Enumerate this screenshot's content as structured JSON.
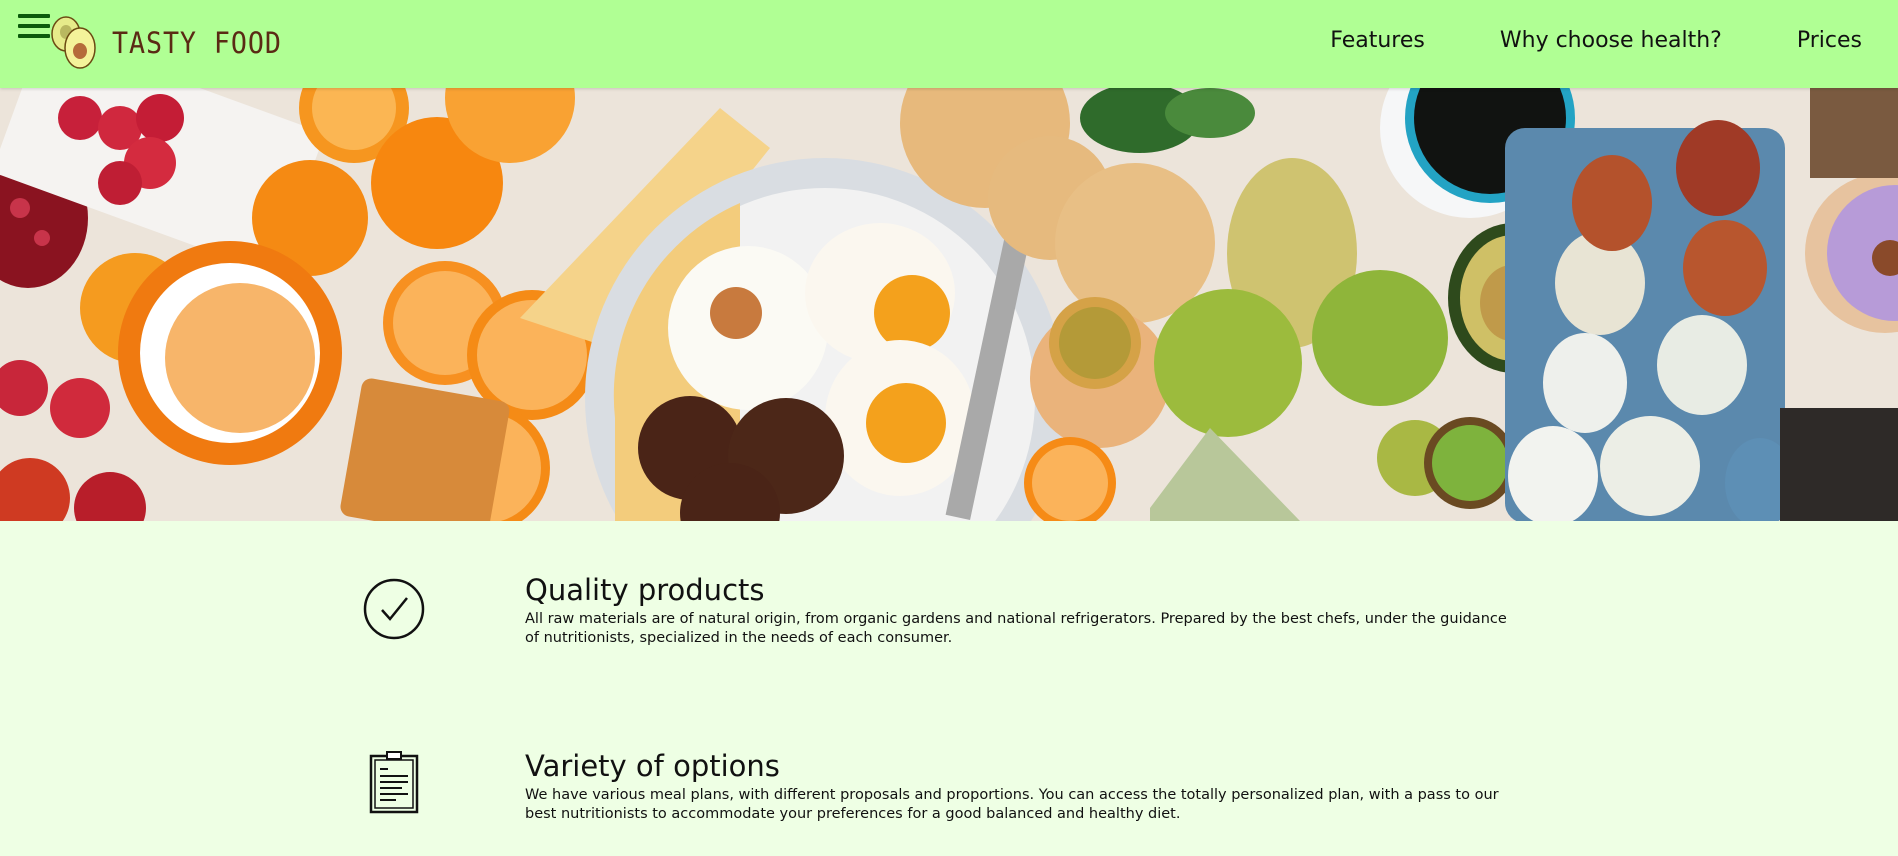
{
  "header": {
    "brand": "TASTY FOOD",
    "menu_icon": "hamburger-menu-icon",
    "logo_icon": "avocado-logo-icon",
    "nav": [
      {
        "label": "Features"
      },
      {
        "label": "Why choose health?"
      },
      {
        "label": "Prices"
      }
    ],
    "colors": {
      "background": "#b0ff94",
      "brand_text": "#5a2a14",
      "menu_icon": "#0b5a0b"
    }
  },
  "hero": {
    "image": "breakfast-foods-flatlay"
  },
  "features": [
    {
      "icon": "checkmark-circle-icon",
      "title": "Quality products",
      "text": "All raw materials are of natural origin, from organic gardens and national refrigerators. Prepared by the best chefs, under the guidance of nutritionists, specialized in the needs of each consumer."
    },
    {
      "icon": "clipboard-icon",
      "title": "Variety of options",
      "text": "We have various meal plans, with different proposals and proportions. You can access the totally personalized plan, with a pass to our best nutritionists to accommodate your preferences for a good balanced and healthy diet."
    }
  ],
  "page": {
    "background": "#eeffe4"
  }
}
